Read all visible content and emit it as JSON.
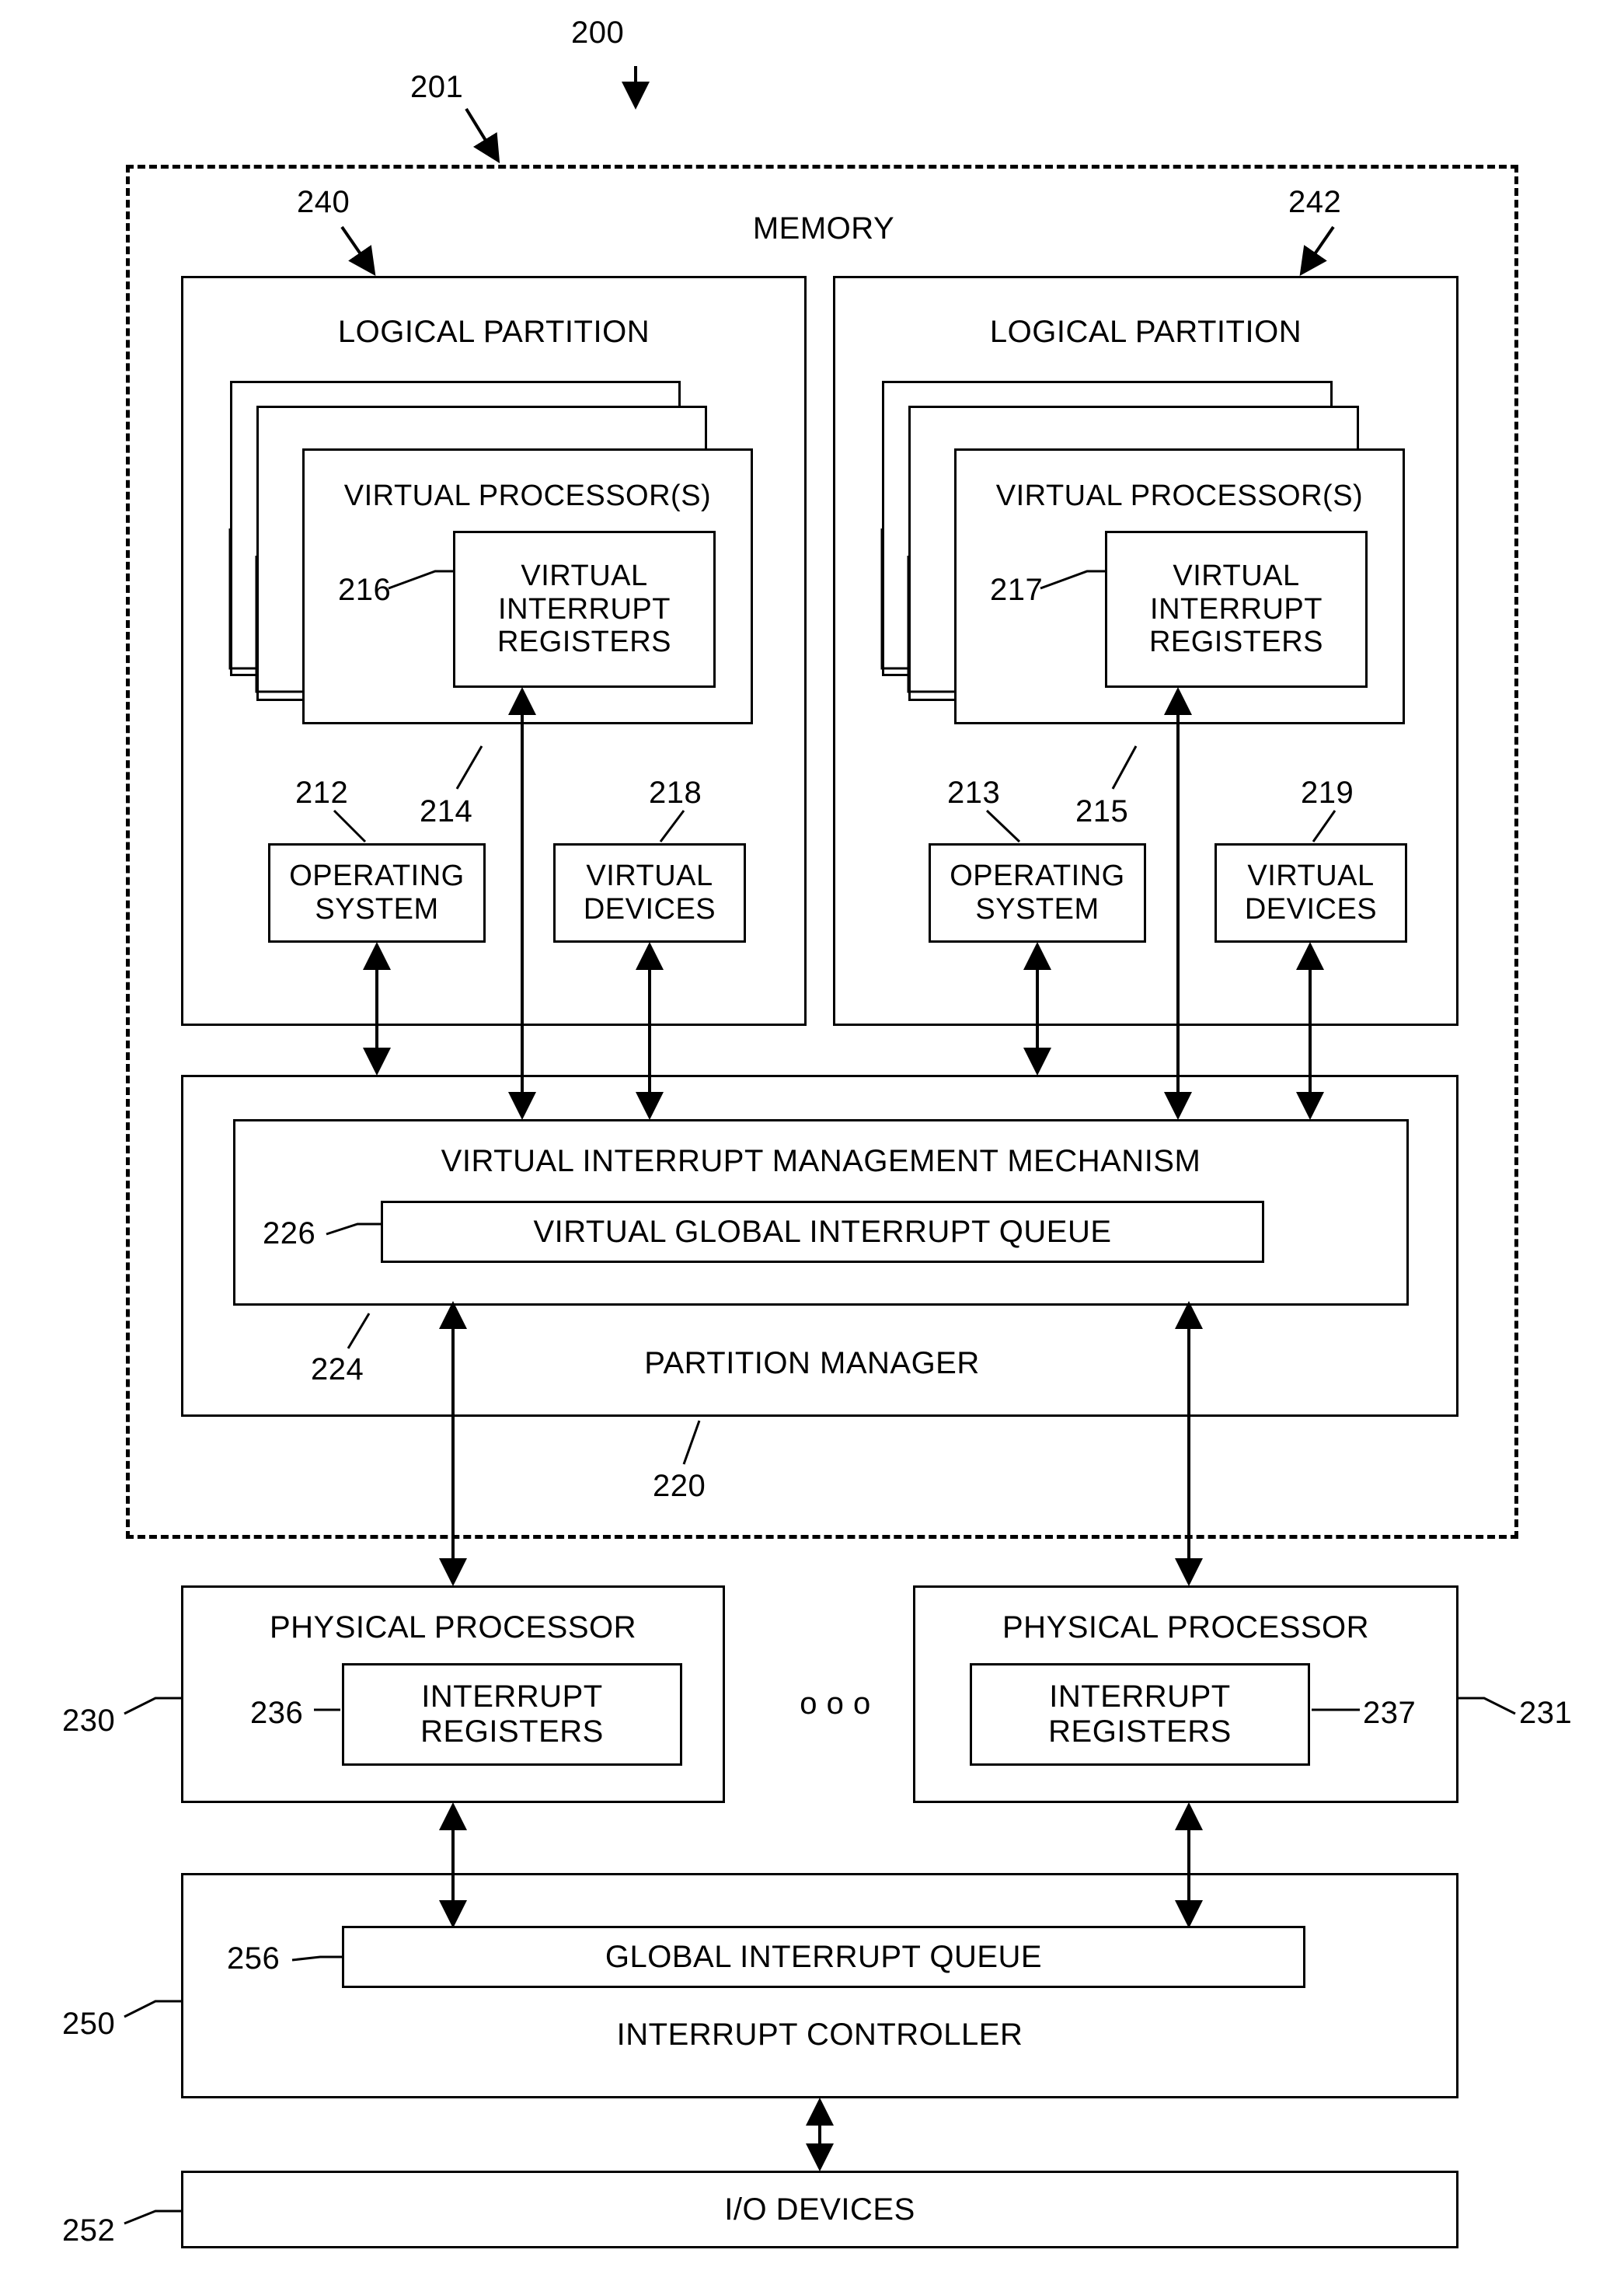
{
  "figure": {
    "title_ref": "200",
    "system_ref": "201",
    "memory_label": "MEMORY"
  },
  "refs": {
    "r200": "200",
    "r201": "201",
    "r240": "240",
    "r242": "242",
    "r216": "216",
    "r217": "217",
    "r212": "212",
    "r214": "214",
    "r218": "218",
    "r213": "213",
    "r215": "215",
    "r219": "219",
    "r226": "226",
    "r224": "224",
    "r220": "220",
    "r230": "230",
    "r236": "236",
    "r237": "237",
    "r231": "231",
    "r250": "250",
    "r256": "256",
    "r252": "252"
  },
  "partitions": [
    {
      "title": "LOGICAL PARTITION",
      "virtual_processors": "VIRTUAL PROCESSOR(S)",
      "virtual_interrupt_registers": "VIRTUAL\nINTERRUPT\nREGISTERS",
      "operating_system": "OPERATING\nSYSTEM",
      "virtual_devices": "VIRTUAL\nDEVICES"
    },
    {
      "title": "LOGICAL PARTITION",
      "virtual_processors": "VIRTUAL PROCESSOR(S)",
      "virtual_interrupt_registers": "VIRTUAL\nINTERRUPT\nREGISTERS",
      "operating_system": "OPERATING\nSYSTEM",
      "virtual_devices": "VIRTUAL\nDEVICES"
    }
  ],
  "partition_manager": {
    "mechanism_label": "VIRTUAL INTERRUPT MANAGEMENT MECHANISM",
    "queue_label": "VIRTUAL GLOBAL INTERRUPT QUEUE",
    "manager_label": "PARTITION MANAGER"
  },
  "physical_processors": [
    {
      "title": "PHYSICAL PROCESSOR",
      "registers": "INTERRUPT\nREGISTERS"
    },
    {
      "title": "PHYSICAL PROCESSOR",
      "registers": "INTERRUPT\nREGISTERS"
    }
  ],
  "ellipsis": "o  o  o",
  "interrupt_controller": {
    "queue_label": "GLOBAL  INTERRUPT QUEUE",
    "title": "INTERRUPT CONTROLLER"
  },
  "io_devices": {
    "label": "I/O DEVICES"
  }
}
